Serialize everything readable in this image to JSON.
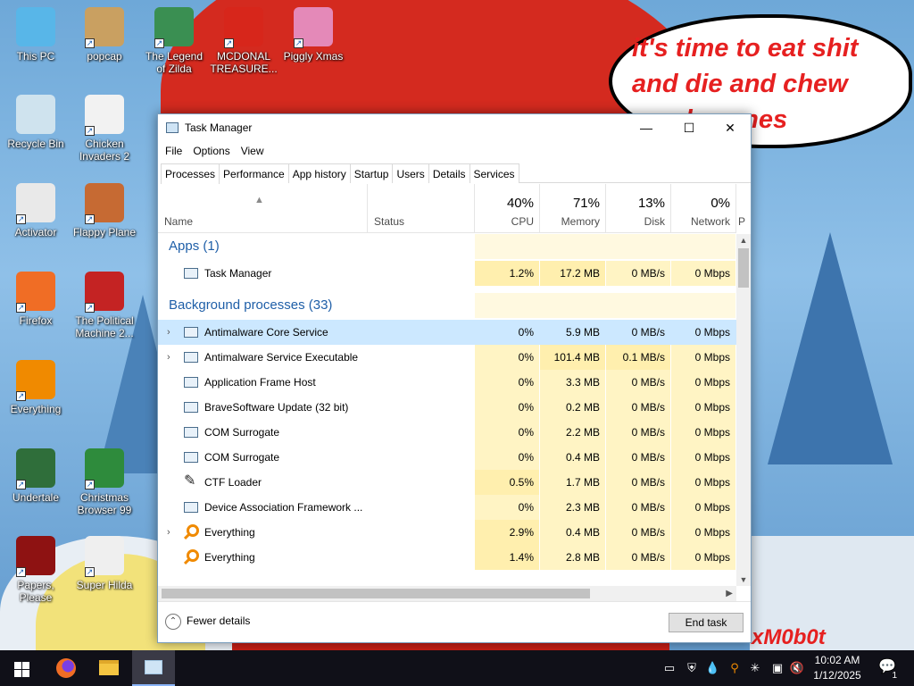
{
  "wallpaper": {
    "speech_bubble": "it's time to eat shit and die and chew candy canes",
    "watermark": "xM0b0t"
  },
  "desktop_icons": [
    {
      "label": "This PC",
      "color": "#58b6e8",
      "icon": "this-pc-icon"
    },
    {
      "label": "popcap",
      "color": "#c9a061",
      "icon": "folder-icon"
    },
    {
      "label": "The Legend of Zilda",
      "color": "#3a8f52",
      "icon": "zilda-icon"
    },
    {
      "label": "MCDONAL TREASURE...",
      "color": "#d7261b",
      "icon": "mcdonald-icon"
    },
    {
      "label": "Piggly Xmas",
      "color": "#e489b8",
      "icon": "piggly-icon"
    },
    {
      "label": "Recycle Bin",
      "color": "#cfe3ee",
      "icon": "recycle-bin-icon"
    },
    {
      "label": "Chicken Invaders 2",
      "color": "#f2f2f2",
      "icon": "chicken-icon"
    },
    {
      "label": "Activator",
      "color": "#e9e9e9",
      "icon": "activator-icon"
    },
    {
      "label": "Flappy Plane",
      "color": "#c66a33",
      "icon": "flappy-plane-icon"
    },
    {
      "label": "Firefox",
      "color": "#f06d25",
      "icon": "firefox-icon"
    },
    {
      "label": "The Political Machine 2...",
      "color": "#c42323",
      "icon": "political-machine-icon"
    },
    {
      "label": "Everything",
      "color": "#f08a00",
      "icon": "everything-icon"
    },
    {
      "label": "Undertale",
      "color": "#2f6e3a",
      "icon": "undertale-icon"
    },
    {
      "label": "Christmas Browser 99",
      "color": "#2e8b3c",
      "icon": "christmas-browser-icon"
    },
    {
      "label": "Papers, Please",
      "color": "#8e1212",
      "icon": "papers-please-icon"
    },
    {
      "label": "Super Hilda",
      "color": "#efefef",
      "icon": "super-hilda-icon"
    }
  ],
  "task_manager": {
    "title": "Task Manager",
    "window_buttons": {
      "minimize": "—",
      "maximize": "☐",
      "close": "✕"
    },
    "menu": [
      "File",
      "Options",
      "View"
    ],
    "tabs": [
      "Processes",
      "Performance",
      "App history",
      "Startup",
      "Users",
      "Details",
      "Services"
    ],
    "active_tab": "Processes",
    "columns": {
      "name": "Name",
      "status": "Status",
      "cpu": {
        "pct": "40%",
        "label": "CPU"
      },
      "memory": {
        "pct": "71%",
        "label": "Memory"
      },
      "disk": {
        "pct": "13%",
        "label": "Disk"
      },
      "network": {
        "pct": "0%",
        "label": "Network"
      },
      "power": "P"
    },
    "apps_group": "Apps (1)",
    "background_group": "Background processes (33)",
    "apps": [
      {
        "name": "Task Manager",
        "cpu": "1.2%",
        "memory": "17.2 MB",
        "disk": "0 MB/s",
        "network": "0 Mbps",
        "icon": "task-manager-icon"
      }
    ],
    "background": [
      {
        "name": "Antimalware Core Service",
        "cpu": "0%",
        "memory": "5.9 MB",
        "disk": "0 MB/s",
        "network": "0 Mbps",
        "expand": true,
        "icon": "service-window-icon",
        "selected": true
      },
      {
        "name": "Antimalware Service Executable",
        "cpu": "0%",
        "memory": "101.4 MB",
        "disk": "0.1 MB/s",
        "network": "0 Mbps",
        "expand": true,
        "icon": "service-window-icon"
      },
      {
        "name": "Application Frame Host",
        "cpu": "0%",
        "memory": "3.3 MB",
        "disk": "0 MB/s",
        "network": "0 Mbps",
        "icon": "service-window-icon"
      },
      {
        "name": "BraveSoftware Update (32 bit)",
        "cpu": "0%",
        "memory": "0.2 MB",
        "disk": "0 MB/s",
        "network": "0 Mbps",
        "icon": "brave-update-icon"
      },
      {
        "name": "COM Surrogate",
        "cpu": "0%",
        "memory": "2.2 MB",
        "disk": "0 MB/s",
        "network": "0 Mbps",
        "icon": "service-window-icon"
      },
      {
        "name": "COM Surrogate",
        "cpu": "0%",
        "memory": "0.4 MB",
        "disk": "0 MB/s",
        "network": "0 Mbps",
        "icon": "service-window-icon"
      },
      {
        "name": "CTF Loader",
        "cpu": "0.5%",
        "memory": "1.7 MB",
        "disk": "0 MB/s",
        "network": "0 Mbps",
        "icon": "pen-icon"
      },
      {
        "name": "Device Association Framework ...",
        "cpu": "0%",
        "memory": "2.3 MB",
        "disk": "0 MB/s",
        "network": "0 Mbps",
        "icon": "service-window-icon"
      },
      {
        "name": "Everything",
        "cpu": "2.9%",
        "memory": "0.4 MB",
        "disk": "0 MB/s",
        "network": "0 Mbps",
        "expand": true,
        "icon": "everything-icon"
      },
      {
        "name": "Everything",
        "cpu": "1.4%",
        "memory": "2.8 MB",
        "disk": "0 MB/s",
        "network": "0 Mbps",
        "icon": "everything-icon"
      }
    ],
    "footer": {
      "fewer_details": "Fewer details",
      "end_task": "End task"
    }
  },
  "taskbar": {
    "time": "10:02 AM",
    "date": "1/12/2025",
    "notification_count": "1",
    "pinned": [
      "firefox-icon",
      "file-explorer-icon",
      "task-manager-icon"
    ],
    "tray_icons": [
      "network-adapter-icon",
      "defender-icon",
      "water-drop-icon",
      "everything-icon",
      "snowflake-icon",
      "network-icon",
      "volume-muted-icon"
    ]
  }
}
